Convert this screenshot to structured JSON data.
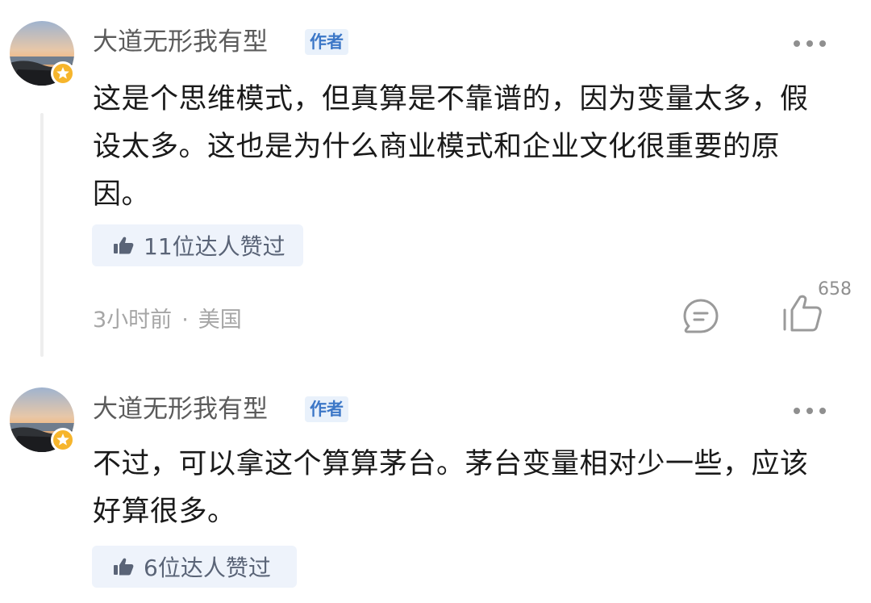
{
  "comments": [
    {
      "username": "大道无形我有型",
      "tag": "作者",
      "text": "这是个思维模式，但真算是不靠谱的，因为变量太多，假设太多。这也是为什么商业模式和企业文化很重要的原因。",
      "likes_summary": "11位达人赞过",
      "time": "3小时前",
      "separator": "·",
      "location": "美国",
      "like_count": "658",
      "icons": [
        "more-icon",
        "thumbs-up-icon",
        "reply-icon",
        "like-icon",
        "author-star-badge-icon"
      ]
    },
    {
      "username": "大道无形我有型",
      "tag": "作者",
      "text": "不过，可以拿这个算算茅台。茅台变量相对少一些，应该好算很多。",
      "likes_summary": "6位达人赞过",
      "icons": [
        "more-icon",
        "thumbs-up-icon",
        "author-star-badge-icon"
      ]
    }
  ],
  "colors": {
    "tag_text": "#3c77c7",
    "tag_bg": "#e9f1fb",
    "pill_bg": "#eef3fb",
    "badge": "#f6b52c",
    "meta_text": "#a6a6a6"
  }
}
